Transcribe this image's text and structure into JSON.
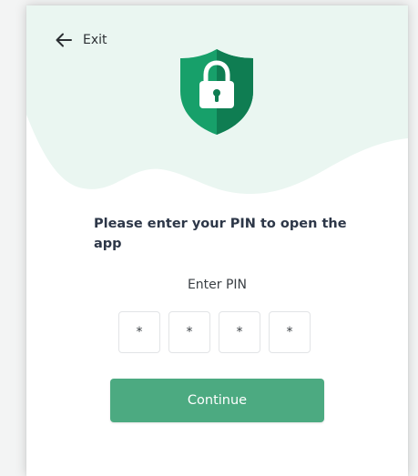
{
  "colors": {
    "accent": "#4caa81",
    "shield": "#17a06a",
    "shield_dark": "#0f7d52",
    "blob": "#eaf6f1"
  },
  "header": {
    "back_icon": "arrow-left-icon",
    "exit_label": "Exit"
  },
  "hero": {
    "icon": "shield-lock-icon"
  },
  "prompt": {
    "text": "Please enter your PIN to open the app"
  },
  "pin": {
    "label": "Enter PIN",
    "digits": [
      "*",
      "*",
      "*",
      "*"
    ]
  },
  "actions": {
    "continue_label": "Continue"
  }
}
